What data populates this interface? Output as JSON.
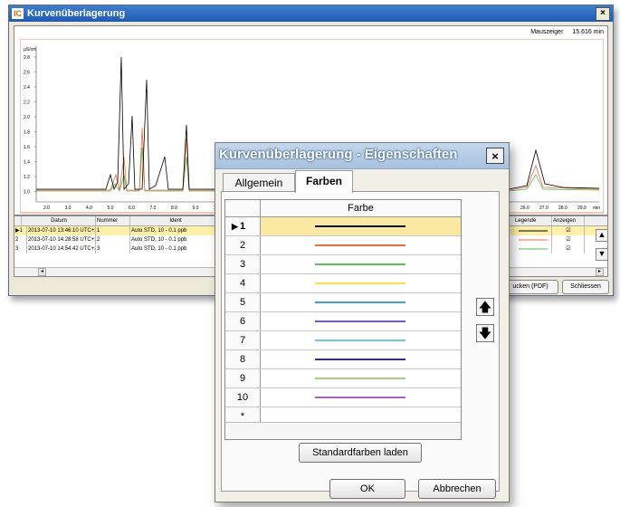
{
  "background_window": {
    "title": "Kurvenüberlagerung",
    "logo": "IC",
    "close": "×",
    "mouse_label": "Mauszeiger",
    "mouse_value": "15.616 min",
    "y_unit": "µS/cm",
    "y_ticks": [
      "2.8",
      "2.6",
      "2.4",
      "2.2",
      "2.0",
      "1.8",
      "1.6",
      "1.4",
      "1.2",
      "1.0"
    ],
    "x_ticks_left": [
      "2.0",
      "3.0",
      "4.0",
      "5.0",
      "6.0",
      "7.0",
      "8.0",
      "9.0",
      "10.0"
    ],
    "x_ticks_right": [
      "26.0",
      "27.0",
      "28.0",
      "29.0"
    ],
    "x_unit": "min",
    "table": {
      "headers": [
        "Datum",
        "Nummer",
        "Ident",
        "Legende",
        "Anzeigen"
      ],
      "rows": [
        {
          "idx": "1",
          "date": "2013-07-10 13:46:10 UTC+2",
          "num": "1",
          "ident": "Auto STD, 10 - 0.1 ppb"
        },
        {
          "idx": "2",
          "date": "2013-07-10 14:28:58 UTC+2",
          "num": "2",
          "ident": "Auto STD, 10 - 0.1 ppb"
        },
        {
          "idx": "3",
          "date": "2013-07-10 14:54:42 UTC+2",
          "num": "3",
          "ident": "Auto STD, 10 - 0.1 ppb"
        }
      ]
    },
    "btn_print": "ucken (PDF)",
    "btn_close": "Schliessen",
    "colors": {
      "line1": "#000000",
      "line2": "#ef6a3c",
      "line3": "#59b95a",
      "frame": "#ef8a6c"
    }
  },
  "dialog": {
    "title": "Kurvenüberlagerung - Eigenschaften",
    "close": "×",
    "tabs": [
      "Allgemein",
      "Farben"
    ],
    "grid_header": "Farbe",
    "rows": [
      {
        "label": "1",
        "color": "#000000"
      },
      {
        "label": "2",
        "color": "#f26b3a"
      },
      {
        "label": "3",
        "color": "#5cbf5a"
      },
      {
        "label": "4",
        "color": "#f5e34a"
      },
      {
        "label": "5",
        "color": "#3aa0e0"
      },
      {
        "label": "6",
        "color": "#7b57c4"
      },
      {
        "label": "7",
        "color": "#62cfd0"
      },
      {
        "label": "8",
        "color": "#2c2f94"
      },
      {
        "label": "9",
        "color": "#9fd27a"
      },
      {
        "label": "10",
        "color": "#b15cc8"
      }
    ],
    "new_row_label": "*",
    "load_defaults": "Standardfarben laden",
    "ok": "OK",
    "cancel": "Abbrechen"
  }
}
